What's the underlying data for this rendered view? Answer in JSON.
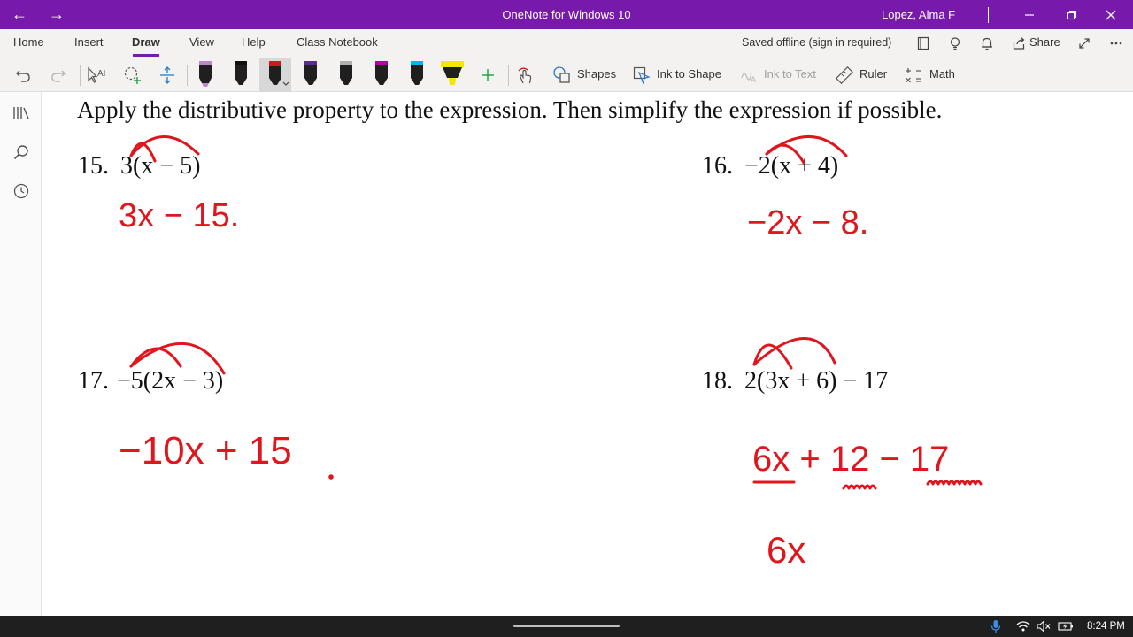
{
  "titlebar": {
    "title": "OneNote for Windows 10",
    "user": "Lopez, Alma F",
    "bg_color": "#7719aa"
  },
  "ribbon": {
    "tabs": [
      {
        "label": "Home"
      },
      {
        "label": "Insert"
      },
      {
        "label": "Draw"
      },
      {
        "label": "View"
      },
      {
        "label": "Help"
      },
      {
        "label": "Class Notebook"
      }
    ],
    "active_tab": "Draw",
    "status": "Saved offline (sign in required)",
    "share_label": "Share"
  },
  "toolbar": {
    "shapes_label": "Shapes",
    "ink_to_shape_label": "Ink to Shape",
    "ink_to_text_label": "Ink to Text",
    "ruler_label": "Ruler",
    "math_label": "Math",
    "pen_colors": [
      "#c084c8",
      "#111111",
      "#d9141e",
      "#1a1a1a",
      "#b0b0b0",
      "#b4009e",
      "#00b7eb",
      "#f5e60a"
    ],
    "ink_color": "#e0161e"
  },
  "worksheet": {
    "instructions": "Apply the distributive property to the expression.  Then simplify the expression if possible.",
    "problems": [
      {
        "number": "15.",
        "expression": "3(x − 5)",
        "answer": "3x − 15."
      },
      {
        "number": "16.",
        "expression": "−2(x + 4)",
        "answer": "−2x − 8."
      },
      {
        "number": "17.",
        "expression": "−5(2x − 3)",
        "answer": "−10x + 15"
      },
      {
        "number": "18.",
        "expression": "2(3x + 6) − 17",
        "answer": "6x + 12 − 17",
        "work": "6x"
      }
    ]
  },
  "taskbar": {
    "time": "8:24 PM"
  }
}
